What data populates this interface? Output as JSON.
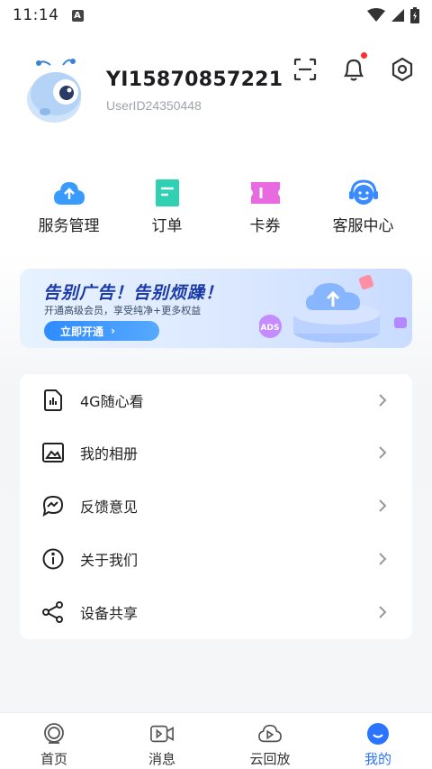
{
  "status_bar": {
    "time": "11:14",
    "a_icon_letter": "A"
  },
  "profile": {
    "username": "YI15870857221",
    "user_id": "UserID24350448"
  },
  "header_actions": [
    "scan-icon",
    "bell-icon",
    "settings-icon"
  ],
  "quick_actions": [
    {
      "label": "服务管理",
      "icon": "cloud-upload-icon",
      "color": "#3a9bff"
    },
    {
      "label": "订单",
      "icon": "order-icon",
      "color": "#2fd1b2"
    },
    {
      "label": "卡券",
      "icon": "coupon-icon",
      "color": "#e86ae0"
    },
    {
      "label": "客服中心",
      "icon": "headset-icon",
      "color": "#3a8bff"
    }
  ],
  "banner": {
    "title": "告别广告！告别烦躁！",
    "subtitle": "开通高级会员，享受纯净+更多权益",
    "button": "立即开通",
    "badge": "ADS"
  },
  "menu": [
    {
      "label": "4G随心看",
      "icon": "sim-card-icon"
    },
    {
      "label": "我的相册",
      "icon": "album-icon"
    },
    {
      "label": "反馈意见",
      "icon": "feedback-icon"
    },
    {
      "label": "关于我们",
      "icon": "info-icon"
    },
    {
      "label": "设备共享",
      "icon": "share-icon"
    }
  ],
  "bottom_nav": [
    {
      "label": "首页",
      "icon": "home-camera-icon",
      "active": false
    },
    {
      "label": "消息",
      "icon": "message-video-icon",
      "active": false
    },
    {
      "label": "云回放",
      "icon": "cloud-play-icon",
      "active": false
    },
    {
      "label": "我的",
      "icon": "profile-face-icon",
      "active": true
    }
  ],
  "colors": {
    "accent": "#2a74ff",
    "notification": "#ff2d2d"
  }
}
